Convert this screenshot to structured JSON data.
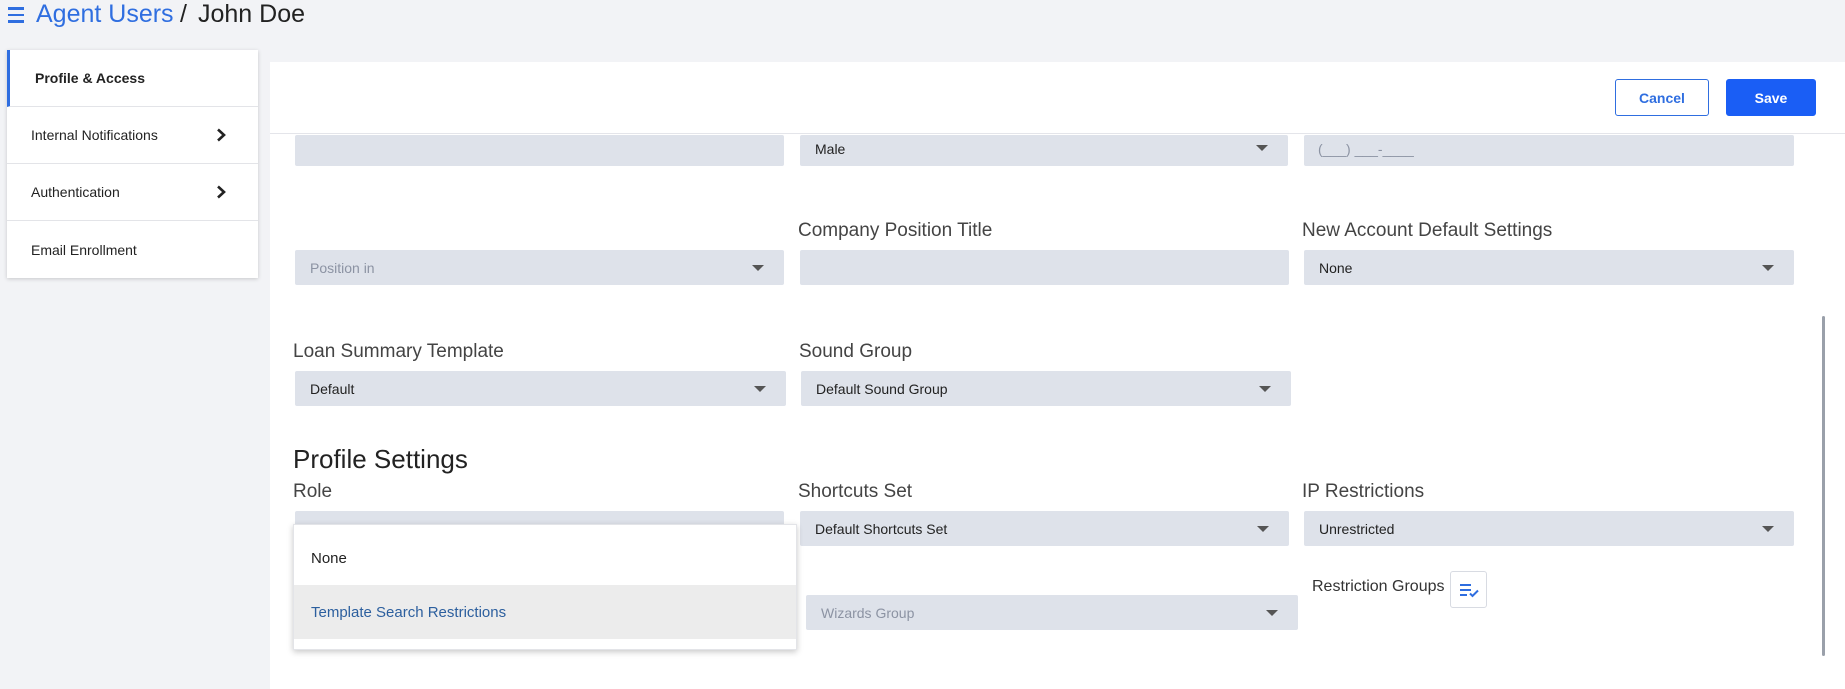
{
  "breadcrumb": {
    "parent": "Agent Users",
    "separator": "/",
    "current": "John Doe"
  },
  "sidebar": {
    "items": [
      {
        "label": "Profile & Access"
      },
      {
        "label": "Internal Notifications"
      },
      {
        "label": "Authentication"
      },
      {
        "label": "Email Enrollment"
      }
    ]
  },
  "toolbar": {
    "cancel_label": "Cancel",
    "save_label": "Save"
  },
  "form": {
    "row1": {
      "gender_value": "Male",
      "phone_placeholder": "(___) ___-____"
    },
    "row2": {
      "position_placeholder": "Position in",
      "company_position_label": "Company Position Title",
      "company_position_value": "",
      "new_account_label": "New Account Default Settings",
      "new_account_value": "None"
    },
    "row3": {
      "loan_summary_label": "Loan Summary Template",
      "loan_summary_value": "Default",
      "sound_group_label": "Sound Group",
      "sound_group_value": "Default Sound Group"
    },
    "profile_settings": {
      "title": "Profile Settings",
      "role_label": "Role",
      "shortcuts_label": "Shortcuts Set",
      "shortcuts_value": "Default Shortcuts Set",
      "ip_label": "IP Restrictions",
      "ip_value": "Unrestricted",
      "wizards_placeholder": "Wizards Group",
      "restriction_groups_label": "Restriction Groups"
    }
  },
  "role_dropdown": {
    "options": [
      {
        "label": "None"
      },
      {
        "label": "Template Search Restrictions"
      }
    ],
    "highlighted_index": 1
  },
  "colors": {
    "accent": "#2f6ee0",
    "save_button": "#1a5ef5",
    "field_bg": "#dee2ea",
    "highlight_text": "#2c5f9e"
  }
}
